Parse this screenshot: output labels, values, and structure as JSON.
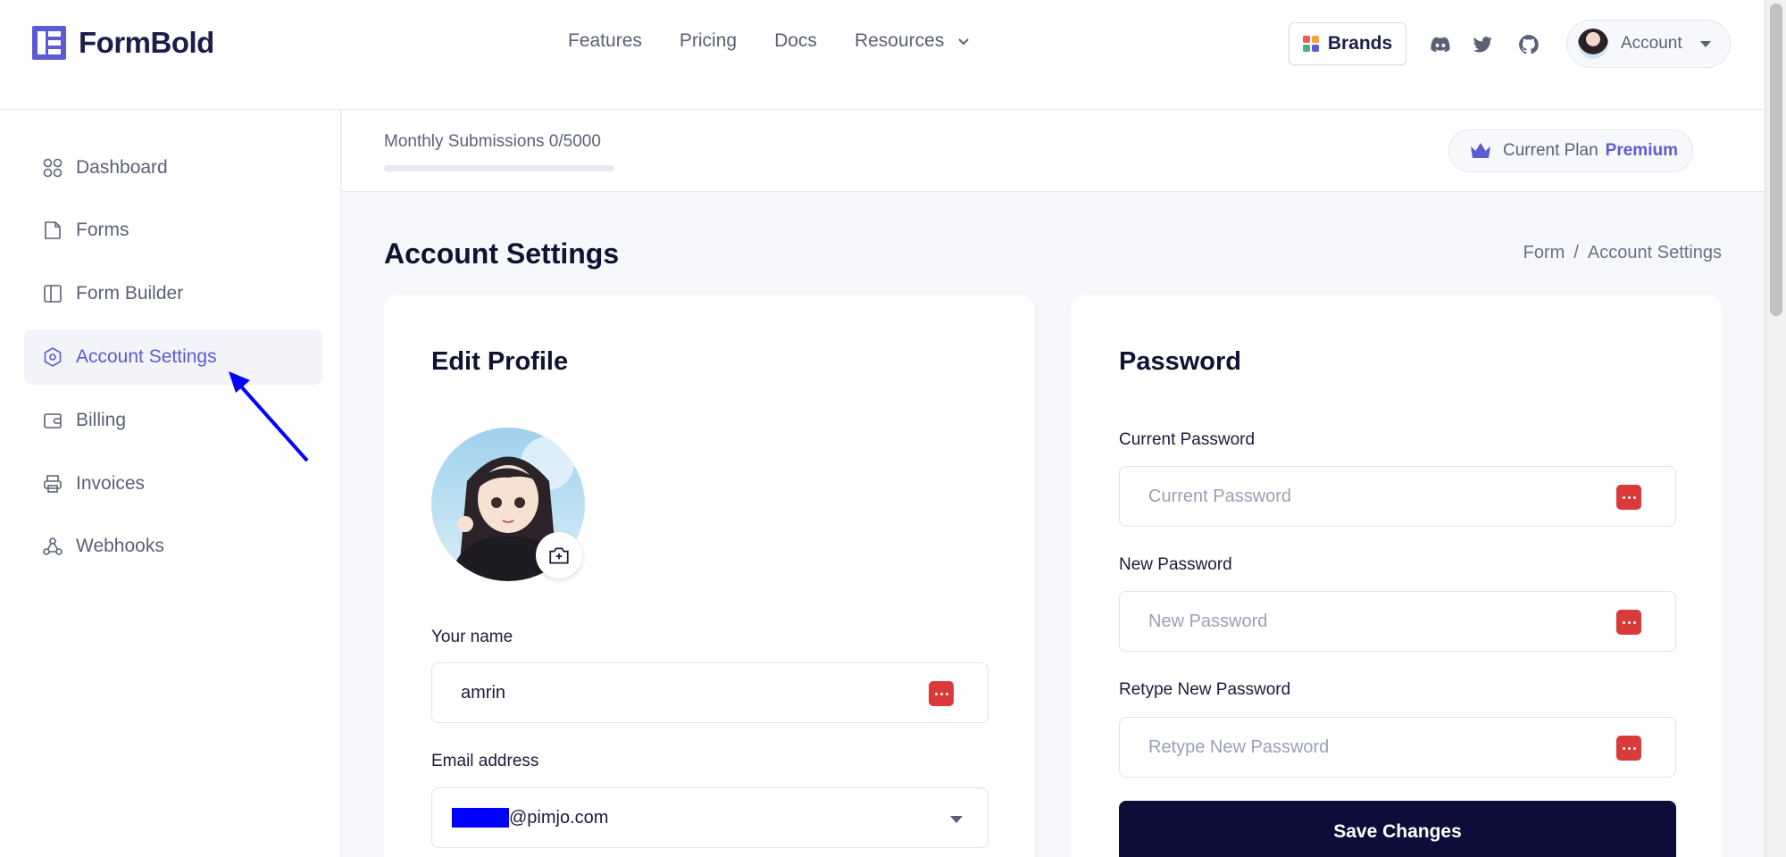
{
  "header": {
    "logo_text": "FormBold",
    "nav": [
      "Features",
      "Pricing",
      "Docs",
      "Resources"
    ],
    "brands_label": "Brands",
    "account_label": "Account"
  },
  "sidebar": {
    "items": [
      {
        "label": "Dashboard",
        "icon": "grid-icon"
      },
      {
        "label": "Forms",
        "icon": "file-icon"
      },
      {
        "label": "Form Builder",
        "icon": "layout-icon"
      },
      {
        "label": "Account Settings",
        "icon": "shield-icon"
      },
      {
        "label": "Billing",
        "icon": "wallet-icon"
      },
      {
        "label": "Invoices",
        "icon": "printer-icon"
      },
      {
        "label": "Webhooks",
        "icon": "webhook-icon"
      }
    ],
    "active": "Account Settings"
  },
  "subbar": {
    "submissions_text": "Monthly Submissions 0/5000",
    "submissions_progress": 0,
    "plan_label": "Current Plan",
    "plan_value": "Premium"
  },
  "page": {
    "title": "Account Settings",
    "breadcrumb": [
      "Form",
      "Account Settings"
    ]
  },
  "profile": {
    "heading": "Edit Profile",
    "name_label": "Your name",
    "name_value": "amrin",
    "email_label": "Email address",
    "email_value": "@pimjo.com"
  },
  "password": {
    "heading": "Password",
    "current_label": "Current Password",
    "current_placeholder": "Current Password",
    "new_label": "New Password",
    "new_placeholder": "New Password",
    "retype_label": "Retype New Password",
    "retype_placeholder": "Retype New Password",
    "save_label": "Save Changes"
  },
  "colors": {
    "accent": "#5b5bd6",
    "primary_button": "#0d0d3a",
    "password_manager_icon": "#d93a3a",
    "annotation_arrow": "#0000ff"
  }
}
